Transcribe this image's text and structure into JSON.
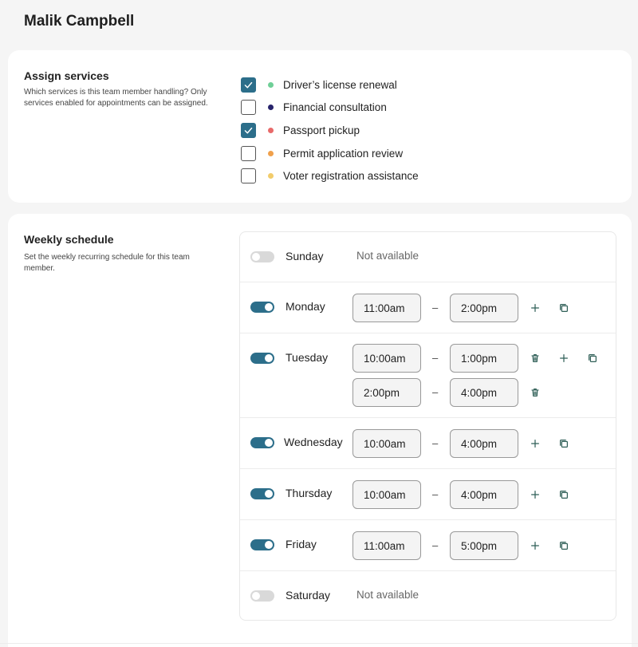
{
  "page": {
    "title": "Malik Campbell"
  },
  "services_section": {
    "title": "Assign services",
    "description": "Which services is this team member handling? Only services enabled for appointments can be assigned.",
    "items": [
      {
        "label": "Driver’s license renewal",
        "checked": true,
        "color": "#6fcf97"
      },
      {
        "label": "Financial consultation",
        "checked": false,
        "color": "#27236b"
      },
      {
        "label": "Passport pickup",
        "checked": true,
        "color": "#e86a6a"
      },
      {
        "label": "Permit application review",
        "checked": false,
        "color": "#f0a04b"
      },
      {
        "label": "Voter registration assistance",
        "checked": false,
        "color": "#f2cc6b"
      }
    ]
  },
  "schedule_section": {
    "title": "Weekly schedule",
    "description": "Set the weekly recurring schedule for this team member.",
    "not_available_label": "Not available",
    "dash": "–",
    "days": [
      {
        "name": "Sunday",
        "enabled": false,
        "ranges": []
      },
      {
        "name": "Monday",
        "enabled": true,
        "ranges": [
          {
            "start": "11:00am",
            "end": "2:00pm"
          }
        ]
      },
      {
        "name": "Tuesday",
        "enabled": true,
        "ranges": [
          {
            "start": "10:00am",
            "end": "1:00pm"
          },
          {
            "start": "2:00pm",
            "end": "4:00pm"
          }
        ]
      },
      {
        "name": "Wednesday",
        "enabled": true,
        "ranges": [
          {
            "start": "10:00am",
            "end": "4:00pm"
          }
        ]
      },
      {
        "name": "Thursday",
        "enabled": true,
        "ranges": [
          {
            "start": "10:00am",
            "end": "4:00pm"
          }
        ]
      },
      {
        "name": "Friday",
        "enabled": true,
        "ranges": [
          {
            "start": "11:00am",
            "end": "5:00pm"
          }
        ]
      },
      {
        "name": "Saturday",
        "enabled": false,
        "ranges": []
      }
    ]
  },
  "colors": {
    "accent": "#2c6e8a",
    "icon": "#2f5f57"
  }
}
